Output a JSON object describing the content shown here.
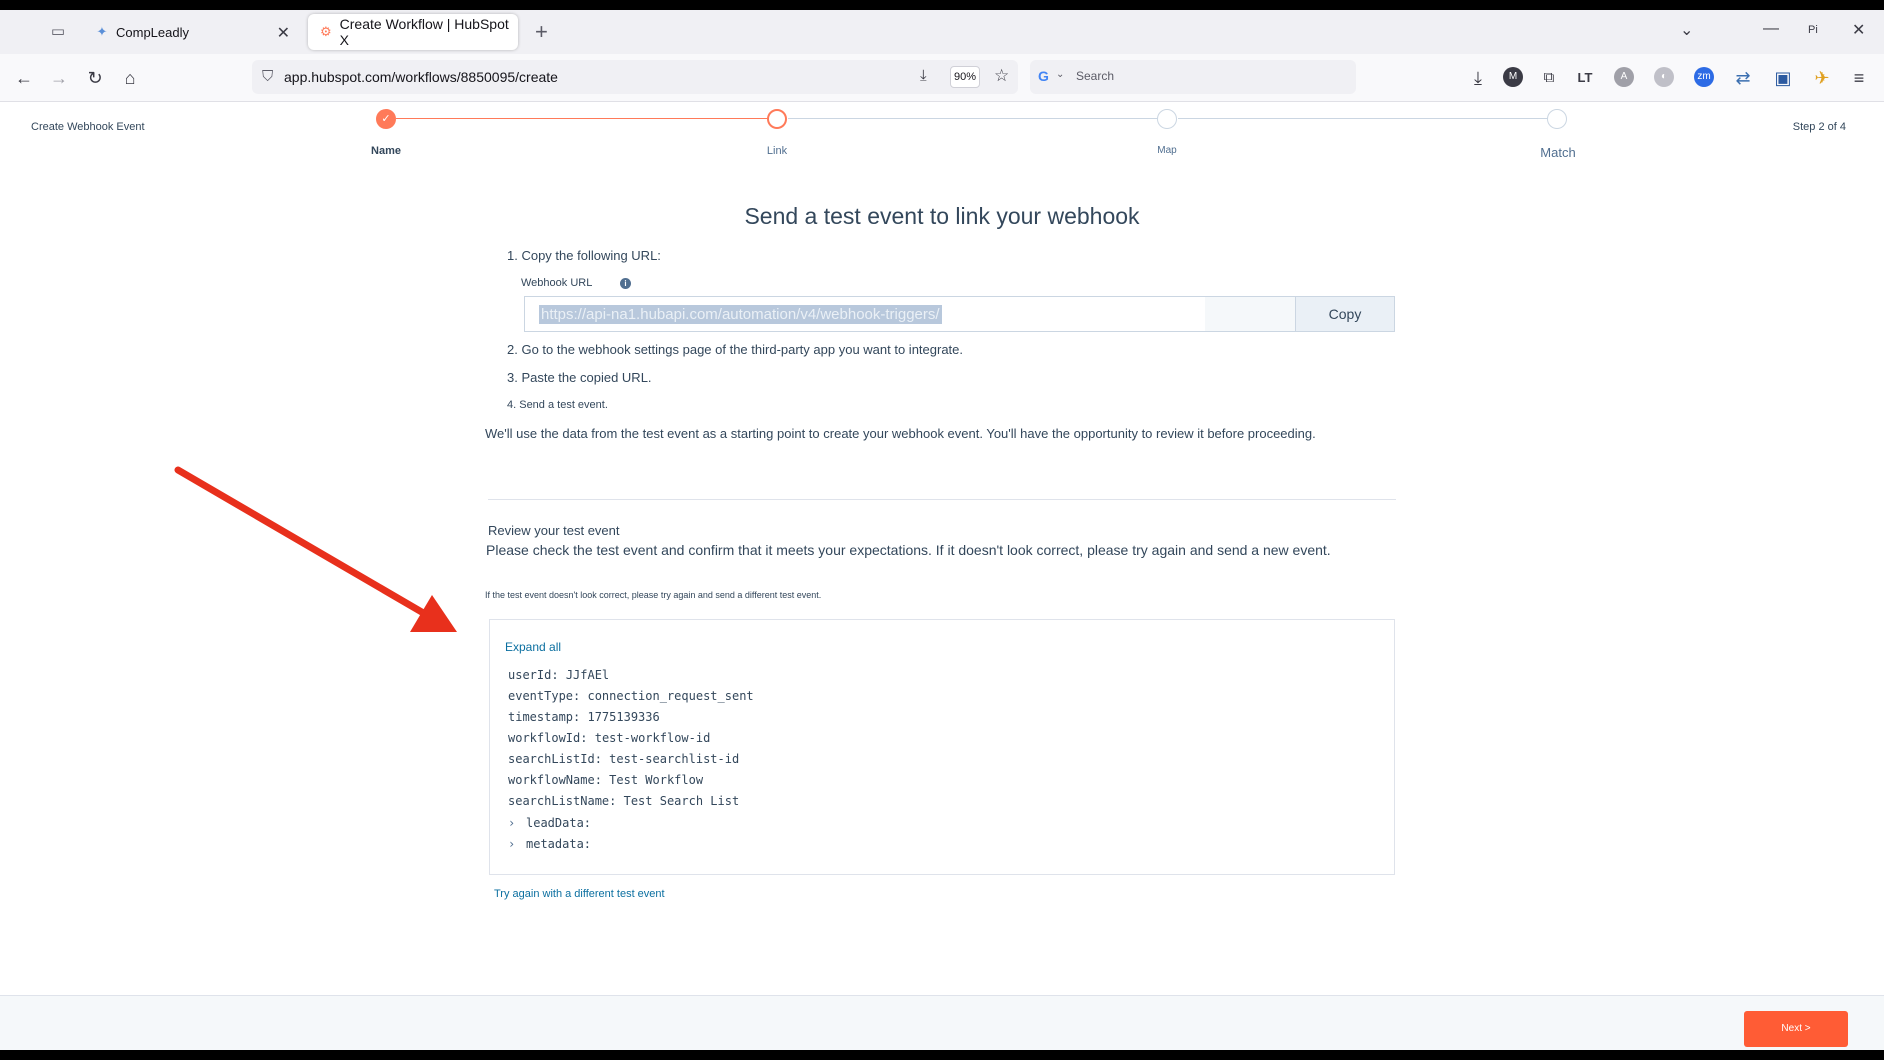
{
  "browser": {
    "tabs": [
      {
        "title": "CompLeadly",
        "favicon": "compleadly-icon",
        "active": false
      },
      {
        "title": "Create Workflow | HubSpot X",
        "favicon": "hubspot-icon",
        "active": true
      }
    ],
    "url": "app.hubspot.com/workflows/8850095/create",
    "zoom": "90%",
    "search_placeholder": "Search",
    "profile_label": "Pi"
  },
  "header": {
    "left_title": "Create Webhook Event",
    "step_count": "Step 2 of 4",
    "steps": [
      {
        "label": "Name",
        "state": "complete"
      },
      {
        "label": "Link",
        "state": "current"
      },
      {
        "label": "Map",
        "state": "upcoming"
      },
      {
        "label": "Match",
        "state": "upcoming"
      }
    ]
  },
  "main": {
    "title": "Send a test event to link your webhook",
    "step1": "1. Copy the following URL:",
    "webhook_label": "Webhook URL",
    "webhook_url": "https://api-na1.hubapi.com/automation/v4/webhook-triggers/",
    "copy_label": "Copy",
    "step2": "2. Go to the webhook settings page of the third-party app you want to integrate.",
    "step3": "3. Paste the copied URL.",
    "step4": "4. Send a test event.",
    "explanation": "We'll use the data from the test event as a starting point to create your webhook event. You'll have the opportunity to review it before proceeding."
  },
  "review": {
    "title": "Review your test event",
    "description": "Please check the test event and confirm that it meets your expectations. If it doesn't look correct, please try again and send a new event.",
    "note": "If the test event doesn't look correct, please try again and send a different test event.",
    "expand_all": "Expand all",
    "fields": [
      {
        "key": "userId:",
        "value": "JJfAEl"
      },
      {
        "key": "eventType:",
        "value": "connection_request_sent"
      },
      {
        "key": "timestamp:",
        "value": "1775139336"
      },
      {
        "key": "workflowId:",
        "value": "test-workflow-id"
      },
      {
        "key": "searchListId:",
        "value": "test-searchlist-id"
      },
      {
        "key": "workflowName:",
        "value": "Test Workflow"
      },
      {
        "key": "searchListName:",
        "value": "Test Search List"
      }
    ],
    "collapsed": [
      {
        "key": "leadData:"
      },
      {
        "key": "metadata:"
      }
    ],
    "try_again": "Try again with a different test event"
  },
  "footer": {
    "next_label": "Next >"
  },
  "colors": {
    "accent": "#ff7a59",
    "next_button": "#ff5c35",
    "annotation_arrow": "#e8301c",
    "link": "#0b6fa0"
  }
}
